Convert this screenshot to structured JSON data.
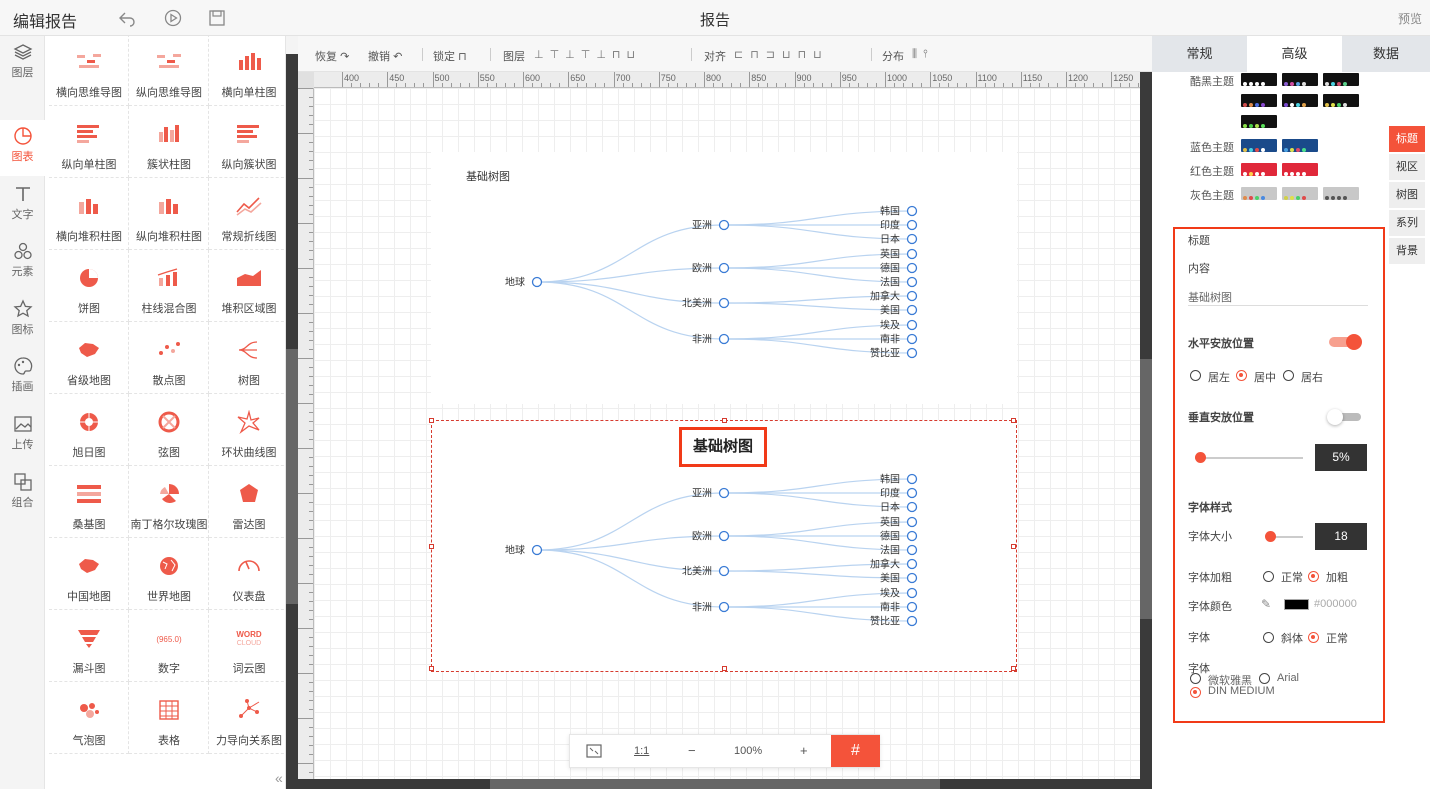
{
  "header": {
    "title": "编辑报告",
    "center_title": "报告",
    "preview": "预览"
  },
  "nav": [
    {
      "label": "图层"
    },
    {
      "label": "图表"
    },
    {
      "label": "文字"
    },
    {
      "label": "元素"
    },
    {
      "label": "图标"
    },
    {
      "label": "插画"
    },
    {
      "label": "上传"
    },
    {
      "label": "组合"
    }
  ],
  "library": [
    {
      "label": "横向思维导图"
    },
    {
      "label": "纵向思维导图"
    },
    {
      "label": "横向单柱图"
    },
    {
      "label": "纵向单柱图"
    },
    {
      "label": "簇状柱图"
    },
    {
      "label": "纵向簇状图"
    },
    {
      "label": "横向堆积柱图"
    },
    {
      "label": "纵向堆积柱图"
    },
    {
      "label": "常规折线图"
    },
    {
      "label": "饼图"
    },
    {
      "label": "柱线混合图"
    },
    {
      "label": "堆积区域图"
    },
    {
      "label": "省级地图"
    },
    {
      "label": "散点图"
    },
    {
      "label": "树图"
    },
    {
      "label": "旭日图"
    },
    {
      "label": "弦图"
    },
    {
      "label": "环状曲线图"
    },
    {
      "label": "桑基图"
    },
    {
      "label": "南丁格尔玫瑰图"
    },
    {
      "label": "雷达图"
    },
    {
      "label": "中国地图"
    },
    {
      "label": "世界地图"
    },
    {
      "label": "仪表盘"
    },
    {
      "label": "漏斗图"
    },
    {
      "label": "数字"
    },
    {
      "label": "词云图"
    },
    {
      "label": "气泡图"
    },
    {
      "label": "表格"
    },
    {
      "label": "力导向关系图"
    }
  ],
  "library_icons": {
    "number_text": "965.0",
    "word_cloud_1": "WORD",
    "word_cloud_2": "CLOUD"
  },
  "toolbar": {
    "redo": "恢复",
    "undo": "撤销",
    "lock": "锁定",
    "layer": "图层",
    "align": "对齐",
    "distribute": "分布"
  },
  "ruler": {
    "h": [
      "400",
      "450",
      "500",
      "550",
      "600",
      "650",
      "700",
      "750",
      "800",
      "850",
      "900",
      "950",
      "1000",
      "1050",
      "1100",
      "1150",
      "1200",
      "1250"
    ]
  },
  "tree1": {
    "title": "基础树图",
    "root": "地球",
    "branches": [
      {
        "name": "亚洲",
        "leaves": [
          "韩国",
          "印度",
          "日本"
        ]
      },
      {
        "name": "欧洲",
        "leaves": [
          "英国",
          "德国",
          "法国"
        ]
      },
      {
        "name": "北美洲",
        "leaves": [
          "加拿大",
          "美国"
        ]
      },
      {
        "name": "非洲",
        "leaves": [
          "埃及",
          "南非",
          "赞比亚"
        ]
      }
    ]
  },
  "tree2": {
    "title": "基础树图"
  },
  "zoom": {
    "fit": "",
    "ratio": "1:1",
    "minus": "−",
    "value": "100%",
    "plus": "+"
  },
  "tabs": [
    "常规",
    "高级",
    "数据"
  ],
  "themes": [
    {
      "label": "酷黑主题"
    },
    {
      "label": "蓝色主题"
    },
    {
      "label": "红色主题"
    },
    {
      "label": "灰色主题"
    }
  ],
  "sidetabs": [
    "标题",
    "视区",
    "树图",
    "系列",
    "背景"
  ],
  "panel": {
    "section": "标题",
    "content_label": "内容",
    "content_value": "基础树图",
    "h_pos_label": "水平安放位置",
    "h_options": [
      "居左",
      "居中",
      "居右"
    ],
    "v_pos_label": "垂直安放位置",
    "v_value": "5%",
    "font_style_label": "字体样式",
    "font_size_label": "字体大小",
    "font_size_value": "18",
    "bold_label": "字体加粗",
    "bold_options": [
      "正常",
      "加粗"
    ],
    "color_label": "字体颜色",
    "color_value": "#000000",
    "italic_label": "字体",
    "italic_options": [
      "斜体",
      "正常"
    ],
    "family_label": "字体",
    "family_options": [
      "微软雅黑",
      "Arial",
      "DIN MEDIUM"
    ]
  },
  "colors": {
    "accent": "#f4533a",
    "tree_node": "#3a7bd5",
    "tree_link": "#b9d3f0"
  }
}
